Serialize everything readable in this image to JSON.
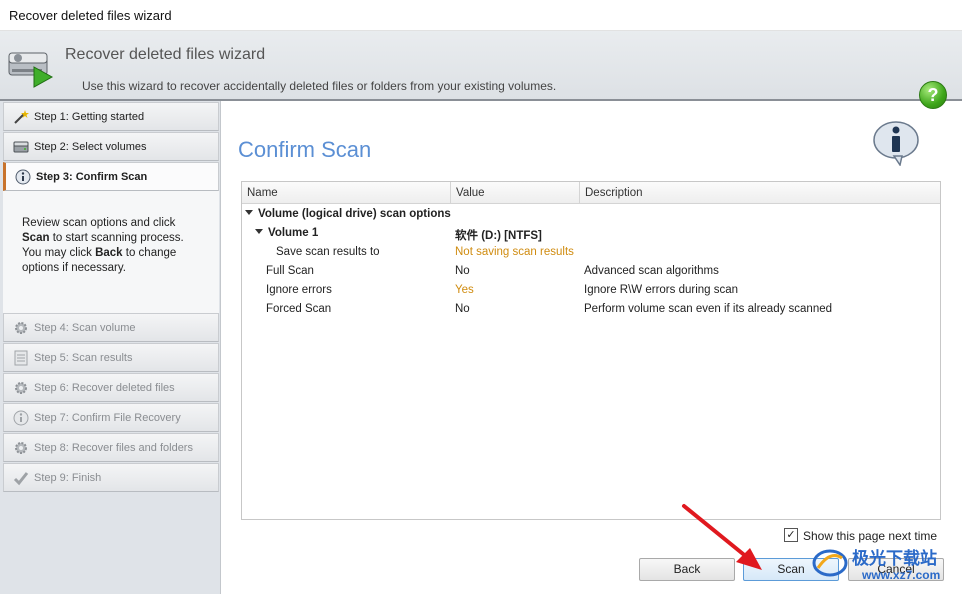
{
  "window": {
    "title": "Recover deleted files wizard"
  },
  "header": {
    "title": "Recover deleted files wizard",
    "subtitle": "Use this wizard to recover accidentally deleted files or folders from your existing volumes.",
    "help_icon": "help-icon",
    "help_glyph": "?"
  },
  "steps": [
    {
      "label": "Step 1: Getting started",
      "icon": "wand-icon",
      "state": "done"
    },
    {
      "label": "Step 2: Select volumes",
      "icon": "drive-icon",
      "state": "done"
    },
    {
      "label": "Step 3: Confirm Scan",
      "icon": "info-icon",
      "state": "active"
    },
    {
      "label": "Step 4: Scan volume",
      "icon": "gear-icon",
      "state": "disabled"
    },
    {
      "label": "Step 5: Scan results",
      "icon": "list-icon",
      "state": "disabled"
    },
    {
      "label": "Step 6: Recover deleted files",
      "icon": "gear-icon",
      "state": "disabled"
    },
    {
      "label": "Step 7: Confirm File Recovery",
      "icon": "info-icon",
      "state": "disabled"
    },
    {
      "label": "Step 8: Recover files and folders",
      "icon": "gear-icon",
      "state": "disabled"
    },
    {
      "label": "Step 9: Finish",
      "icon": "check-icon",
      "state": "disabled"
    }
  ],
  "description": {
    "line1": "Review scan options and click",
    "scan_word": "Scan",
    "line2": " to start scanning process.",
    "line3": "You may click ",
    "back_word": "Back",
    "line4": " to change options if necessary."
  },
  "main": {
    "title": "Confirm Scan"
  },
  "grid": {
    "columns": [
      "Name",
      "Value",
      "Description"
    ],
    "group": "Volume (logical drive) scan options",
    "volume": {
      "name": "Volume 1",
      "value": "软件 (D:) [NTFS]"
    },
    "rows": [
      {
        "name": "Save scan results to",
        "value": "Not saving scan results",
        "description": ""
      },
      {
        "name": "Full Scan",
        "value": "No",
        "description": "Advanced scan algorithms"
      },
      {
        "name": "Ignore errors",
        "value": "Yes",
        "description": "Ignore R\\W errors during scan"
      },
      {
        "name": "Forced Scan",
        "value": "No",
        "description": "Perform volume scan even if its already scanned"
      }
    ]
  },
  "footer": {
    "show_next_time": "Show this page next time",
    "show_next_time_checked": true,
    "check_glyph": "✓",
    "back": "Back",
    "scan": "Scan",
    "cancel": "Cancel"
  },
  "watermark": {
    "text": "极光下载站",
    "url": "www.xz7.com"
  },
  "colors": {
    "accent_title": "#5b8fd4",
    "highlight_value": "#d08c10",
    "active_step_marker": "#c8732c",
    "help_green": "#3ea61a"
  }
}
